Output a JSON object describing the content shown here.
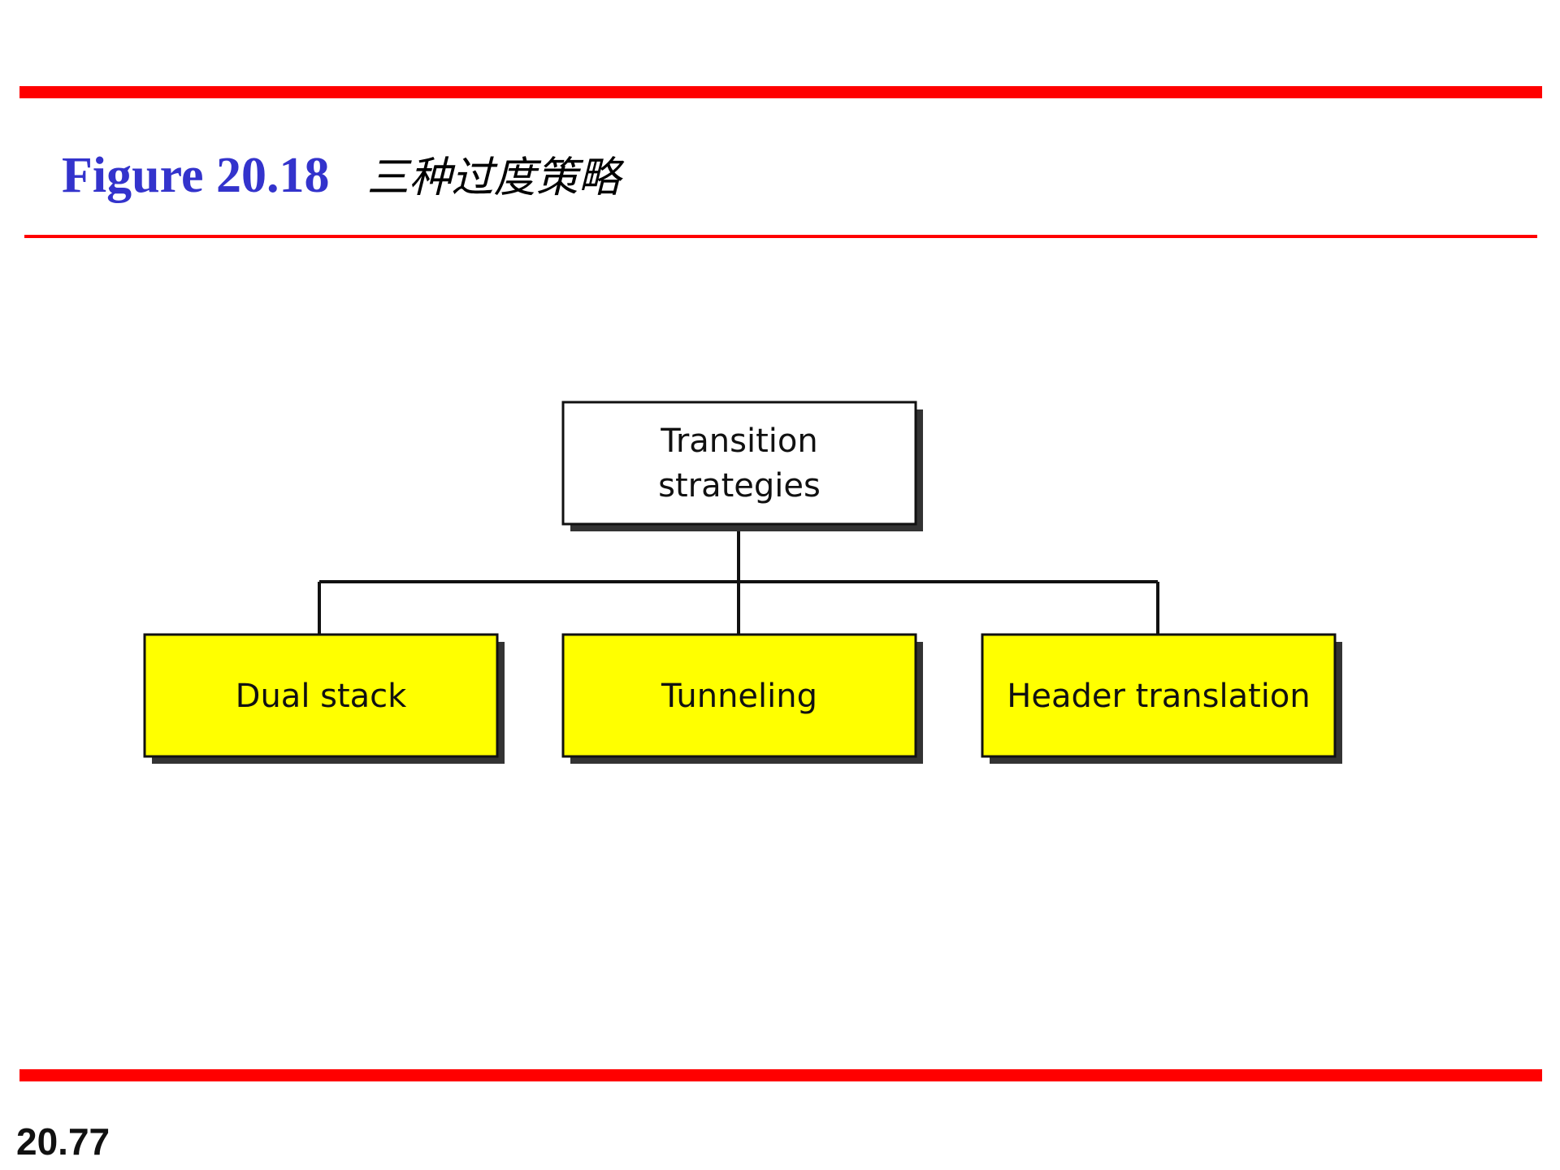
{
  "header": {
    "figure_label": "Figure 20.18",
    "caption": "三种过度策略"
  },
  "diagram": {
    "root": {
      "lines": [
        "Transition",
        "strategies"
      ]
    },
    "children": [
      {
        "label": "Dual stack"
      },
      {
        "label": "Tunneling"
      },
      {
        "label": "Header translation"
      }
    ]
  },
  "footer": {
    "page_number": "20.77"
  },
  "colors": {
    "rule": "#ff0000",
    "title": "#3333cc",
    "child_fill": "#ffff00",
    "root_fill": "#ffffff",
    "outline": "#111111"
  }
}
